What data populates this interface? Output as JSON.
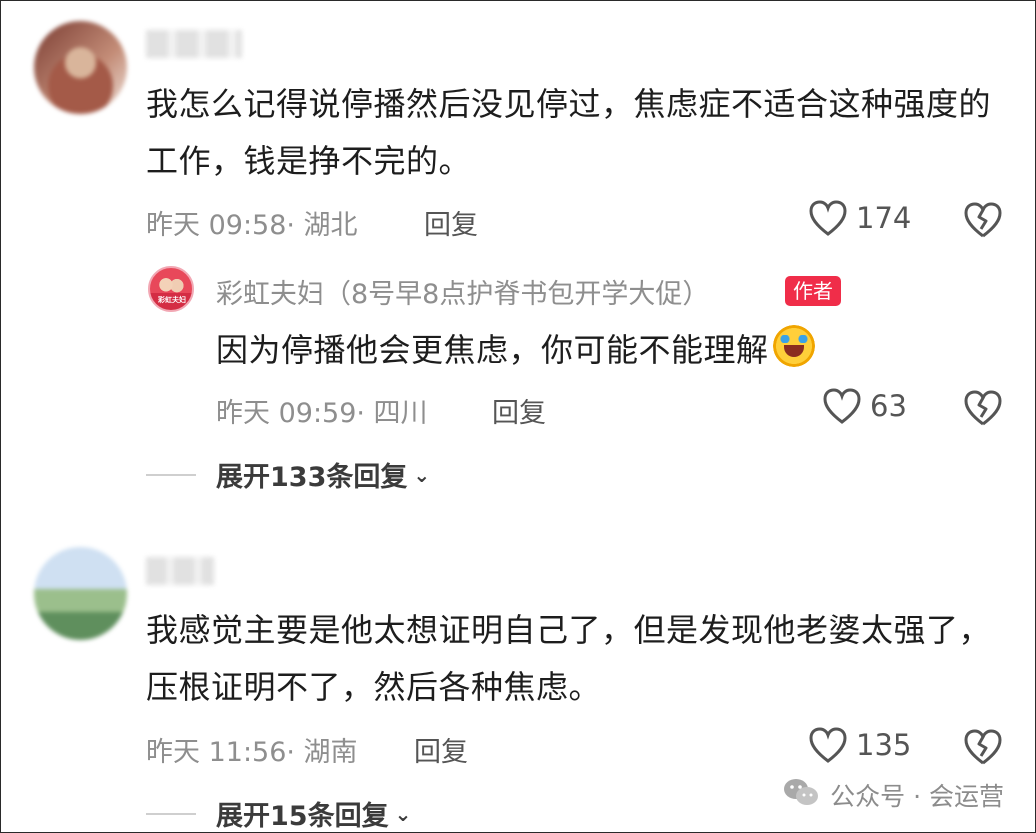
{
  "comments": [
    {
      "text": "我怎么记得说停播然后没见停过，焦虑症不适合这种强度的工作，钱是挣不完的。",
      "meta": "昨天 09:58· 湖北",
      "reply_label": "回复",
      "likes": "174",
      "replies": [
        {
          "author": "彩虹夫妇（8号早8点护脊书包开学大促）",
          "badge": "作者",
          "text": "因为停播他会更焦虑，你可能不能理解",
          "meta": "昨天 09:59· 四川",
          "reply_label": "回复",
          "likes": "63"
        }
      ],
      "expand_label": "展开133条回复"
    },
    {
      "text": "我感觉主要是他太想证明自己了，但是发现他老婆太强了，压根证明不了，然后各种焦虑。",
      "meta": "昨天 11:56· 湖南",
      "reply_label": "回复",
      "likes": "135",
      "expand_label": "展开15条回复"
    }
  ],
  "watermark": "公众号 · 会运营",
  "icons": {
    "like": "heart-icon",
    "dislike": "broken-heart-icon",
    "expand": "chevron-down-icon",
    "watermark": "wechat-icon"
  },
  "colors": {
    "badge": "#f02d49",
    "muted": "#8e8e8e"
  }
}
